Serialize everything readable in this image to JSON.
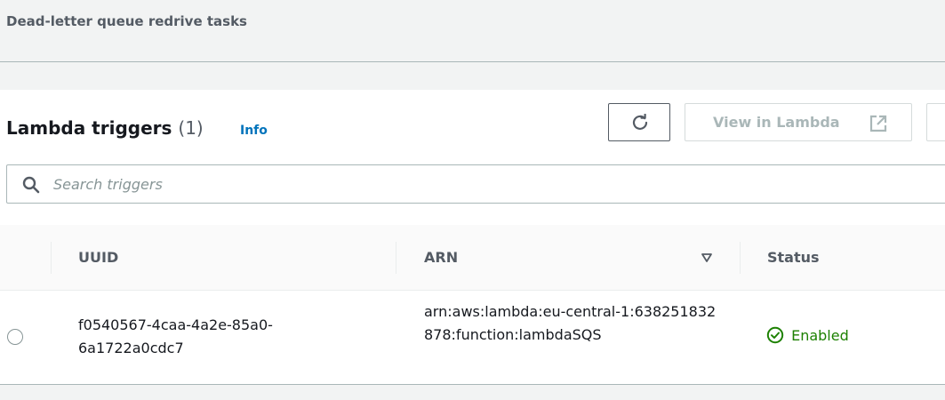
{
  "tab": {
    "label": "Dead-letter queue redrive tasks"
  },
  "panel": {
    "title": "Lambda triggers",
    "count": "(1)",
    "info_label": "Info",
    "buttons": {
      "view_lambda_label": "View in Lambda"
    }
  },
  "search": {
    "placeholder": "Search triggers",
    "value": ""
  },
  "table": {
    "columns": {
      "uuid": "UUID",
      "arn": "ARN",
      "status": "Status"
    },
    "rows": [
      {
        "selected": false,
        "uuid": "f0540567-4caa-4a2e-85a0-6a1722a0cdc7",
        "arn": "arn:aws:lambda:eu-central-1:638251832878:function:lambdaSQS",
        "status": "Enabled"
      }
    ]
  },
  "colors": {
    "link": "#0073bb",
    "success": "#1d8102",
    "disabled": "#aab7b8"
  },
  "icons": {
    "refresh": "refresh-icon",
    "external": "external-link-icon",
    "search": "search-icon",
    "sort": "sort-descending-icon",
    "status": "status-check-icon"
  }
}
